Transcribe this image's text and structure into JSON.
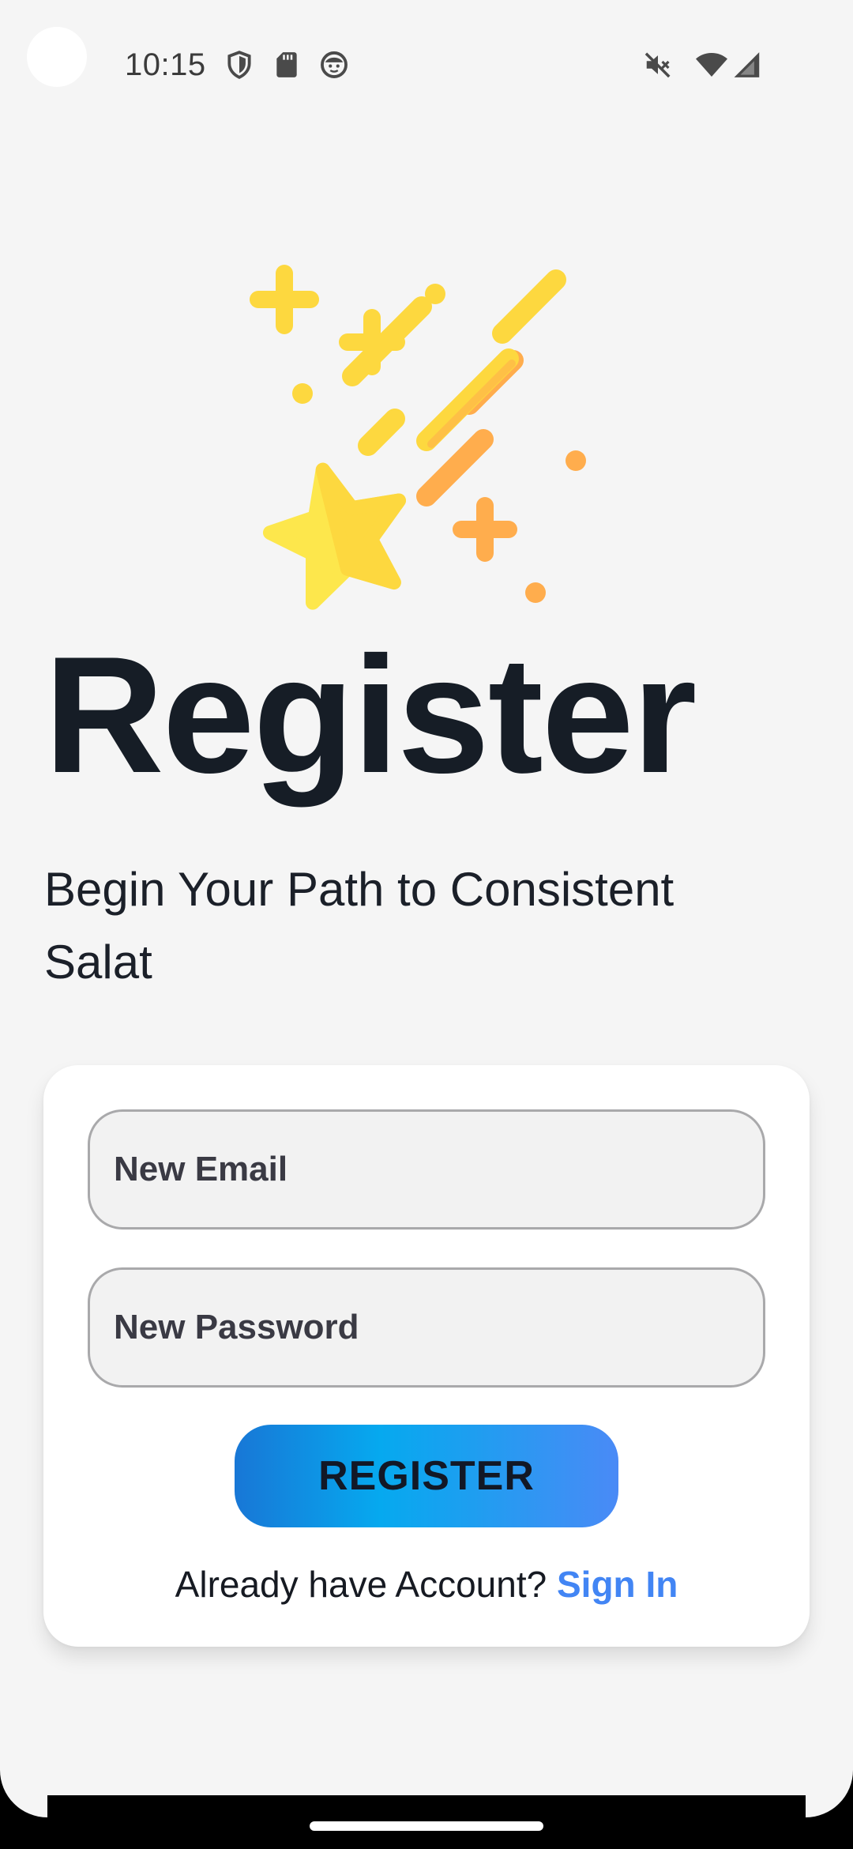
{
  "status_bar": {
    "time": "10:15",
    "left_icons": [
      "shield-icon",
      "sd-card-icon",
      "face-icon"
    ],
    "right_icons": [
      "mute-icon",
      "wifi-icon",
      "signal-icon"
    ]
  },
  "hero": {
    "illustration": "shooting-star-icon",
    "title": "Register",
    "subtitle": "Begin Your Path to Consistent Salat"
  },
  "form": {
    "email_placeholder": "New Email",
    "email_value": "",
    "password_placeholder": "New Password",
    "password_value": "",
    "register_label": "REGISTER",
    "signin_prompt": "Already have Account?",
    "signin_link": "Sign In"
  },
  "colors": {
    "title": "#161d26",
    "link": "#4285f4",
    "button_gradient": [
      "#1877d6",
      "#06a9ef",
      "#4a8af6"
    ],
    "star_yellow": "#fde74c",
    "star_orange": "#ffad4d"
  }
}
